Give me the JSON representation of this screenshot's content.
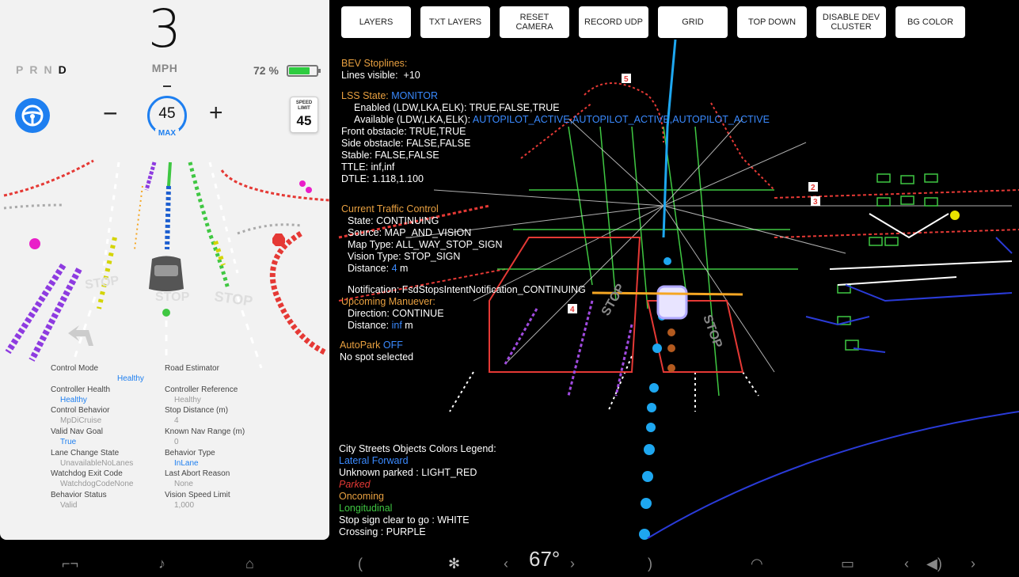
{
  "cluster": {
    "speed": "3",
    "speed_unit": "MPH",
    "gears": [
      "P",
      "R",
      "N",
      "D"
    ],
    "active_gear": "D",
    "battery_percent": "72 %",
    "battery_level": 0.72,
    "set_speed": "45",
    "set_speed_label": "MAX",
    "speed_limit_label": "SPEED LIMIT",
    "speed_limit_value": "45",
    "road_markings": [
      "STOP",
      "STOP",
      "STOP"
    ],
    "colors": {
      "autopilot_blue": "#1e7ff0",
      "battery_green": "#2ecc40"
    }
  },
  "diagnostics": {
    "left": [
      {
        "label": "Control Mode",
        "value": "Healthy",
        "blue": true
      },
      {
        "label": "Controller Health",
        "value": "Healthy",
        "blue": true
      },
      {
        "label": "Control Behavior",
        "value": "MpDiCruise",
        "blue": false
      },
      {
        "label": "Valid Nav Goal",
        "value": "True",
        "blue": true
      },
      {
        "label": "Lane Change State",
        "value": "UnavailableNoLanes",
        "blue": false
      },
      {
        "label": "Watchdog Exit Code",
        "value": "WatchdogCodeNone",
        "blue": false
      },
      {
        "label": "Behavior Status",
        "value": "Valid",
        "blue": false
      }
    ],
    "right": [
      {
        "label": "Road Estimator",
        "value": "",
        "blue": false
      },
      {
        "label": "Controller Reference",
        "value": "Healthy",
        "blue": false
      },
      {
        "label": "Stop Distance (m)",
        "value": "4",
        "blue": false
      },
      {
        "label": "Known Nav Range (m)",
        "value": "0",
        "blue": false
      },
      {
        "label": "Behavior Type",
        "value": "InLane",
        "blue": true
      },
      {
        "label": "Last Abort Reason",
        "value": "None",
        "blue": false
      },
      {
        "label": "Vision Speed Limit",
        "value": "1,000",
        "blue": false
      }
    ]
  },
  "toolbar": {
    "layers": "LAYERS",
    "txt_layers": "TXT LAYERS",
    "reset_camera": "RESET CAMERA",
    "record_udp": "RECORD UDP",
    "grid": "GRID",
    "top_down": "TOP DOWN",
    "disable_dev_cluster": "DISABLE DEV CLUSTER",
    "bg_color": "BG COLOR"
  },
  "debug": {
    "bev_title": "BEV Stoplines:",
    "lines_visible_label": "Lines visible:",
    "lines_visible_value": "+10",
    "lss_label": "LSS State:",
    "lss_value": "MONITOR",
    "enabled_line": "Enabled (LDW,LKA,ELK): TRUE,FALSE,TRUE",
    "available_label": "Available (LDW,LKA,ELK):",
    "available_value": "AUTOPILOT_ACTIVE,AUTOPILOT_ACTIVE,AUTOPILOT_ACTIVE",
    "front_obstacle": "Front obstacle: TRUE,TRUE",
    "side_obstacle": "Side obstacle: FALSE,FALSE",
    "stable": "Stable: FALSE,FALSE",
    "ttle": "TTLE: inf,inf",
    "dtle": "DTLE: 1.118,1.100",
    "traffic_control_title": "Current Traffic Control",
    "state": "State: CONTINUING",
    "source": "Source: MAP_AND_VISION",
    "map_type": "Map Type: ALL_WAY_STOP_SIGN",
    "vision_type": "Vision Type: STOP_SIGN",
    "distance_label": "Distance:",
    "distance_value": "4",
    "distance_unit": "m",
    "notification": "Notification: FsdStopsIntentNotification_CONTINUING",
    "upcoming_title": "Upcoming Manuever:",
    "direction": "Direction: CONTINUE",
    "upcoming_distance_label": "Distance:",
    "upcoming_distance_value": "inf",
    "upcoming_distance_unit": "m",
    "autopark_label": "AutoPark",
    "autopark_value": "OFF",
    "no_spot": "No spot selected",
    "legend_title": "City Streets Objects Colors Legend:",
    "legend_lateral": "Lateral Forward",
    "legend_unknown_parked": "Unknown parked : LIGHT_RED",
    "legend_parked": "Parked",
    "legend_oncoming": "Oncoming",
    "legend_longitudinal": "Longitudinal",
    "legend_stop_clear": "Stop sign clear to go : WHITE",
    "legend_crossing": "Crossing : PURPLE",
    "scene_labels": [
      "5",
      "2",
      "3",
      "4",
      "STOP",
      "STOP"
    ]
  },
  "bottom_bar": {
    "temperature": "67",
    "temperature_unit": "°"
  }
}
